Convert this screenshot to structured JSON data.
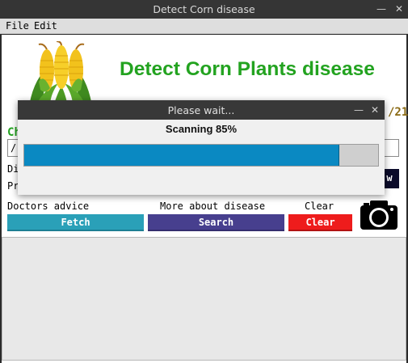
{
  "window": {
    "title": "Detect Corn disease"
  },
  "menu": {
    "items": [
      "File",
      "Edit"
    ]
  },
  "header": {
    "title": "Detect Corn Plants disease"
  },
  "partial": {
    "date_text": "/21",
    "left_label": "Ch",
    "path_text": "/",
    "dis_label": "Di",
    "pr_label": "Pr",
    "view_button": "w"
  },
  "actions": {
    "doctors_label": "Doctors advice",
    "fetch_button": "Fetch",
    "more_label": "More about disease",
    "search_button": "Search",
    "clear_label": "Clear",
    "clear_button": "Clear"
  },
  "dialog": {
    "title": "Please wait...",
    "message": "Scanning 85%",
    "progress": 0.89
  },
  "colors": {
    "title_green": "#23a320",
    "fetch_bg": "#2aa0b8",
    "search_bg": "#473f8e",
    "clear_bg": "#ee1c1c",
    "progress_fill": "#0a89c2",
    "date_color": "#8a6a14"
  }
}
